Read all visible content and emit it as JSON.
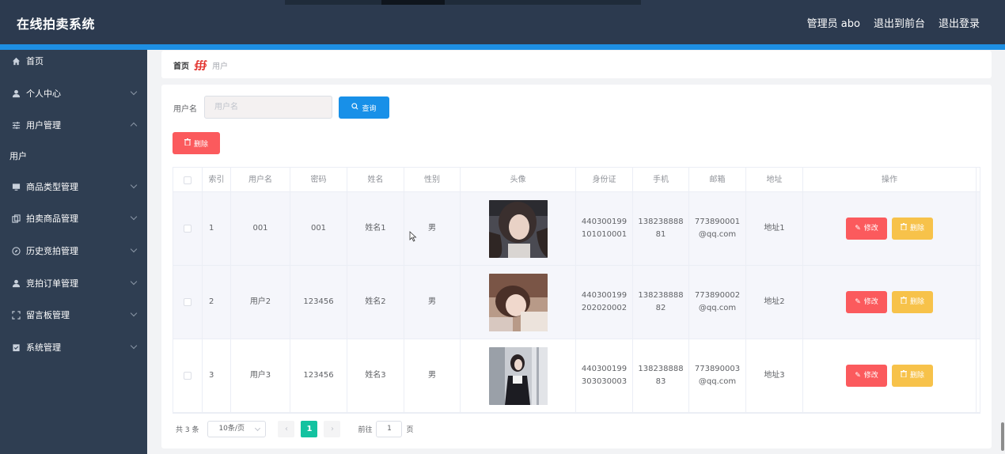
{
  "app": {
    "title": "在线拍卖系统"
  },
  "header": {
    "admin_label": "管理员 abo",
    "front_label": "退出到前台",
    "logout_label": "退出登录"
  },
  "sidebar": {
    "items": [
      {
        "label": "首页",
        "icon": "home-icon"
      },
      {
        "label": "个人中心",
        "icon": "user-icon"
      },
      {
        "label": "用户管理",
        "icon": "sliders-icon"
      },
      {
        "label": "用户",
        "icon": ""
      },
      {
        "label": "商品类型管理",
        "icon": "monitor-icon"
      },
      {
        "label": "拍卖商品管理",
        "icon": "copy-icon"
      },
      {
        "label": "历史竞拍管理",
        "icon": "compass-icon"
      },
      {
        "label": "竞拍订单管理",
        "icon": "user-icon"
      },
      {
        "label": "留言板管理",
        "icon": "frame-icon"
      },
      {
        "label": "系统管理",
        "icon": "clipboard-icon"
      }
    ]
  },
  "breadcrumb": {
    "home": "首页",
    "current": "用户"
  },
  "search": {
    "label": "用户名",
    "placeholder": "用户名",
    "button_label": "查询"
  },
  "actions": {
    "delete_label": "删除"
  },
  "table": {
    "headers": [
      "索引",
      "用户名",
      "密码",
      "姓名",
      "性别",
      "头像",
      "身份证",
      "手机",
      "邮箱",
      "地址",
      "操作"
    ],
    "edit_label": "修改",
    "delete_label": "删除",
    "rows": [
      {
        "index": "1",
        "username": "001",
        "password": "001",
        "name": "姓名1",
        "gender": "男",
        "id_card_1": "440300199",
        "id_card_2": "101010001",
        "phone_1": "138238888",
        "phone_2": "81",
        "email_1": "773890001",
        "email_2": "@qq.com",
        "address": "地址1"
      },
      {
        "index": "2",
        "username": "用户2",
        "password": "123456",
        "name": "姓名2",
        "gender": "男",
        "id_card_1": "440300199",
        "id_card_2": "202020002",
        "phone_1": "138238888",
        "phone_2": "82",
        "email_1": "773890002",
        "email_2": "@qq.com",
        "address": "地址2"
      },
      {
        "index": "3",
        "username": "用户3",
        "password": "123456",
        "name": "姓名3",
        "gender": "男",
        "id_card_1": "440300199",
        "id_card_2": "303030003",
        "phone_1": "138238888",
        "phone_2": "83",
        "email_1": "773890003",
        "email_2": "@qq.com",
        "address": "地址3"
      }
    ]
  },
  "pagination": {
    "total_label": "共 3 条",
    "page_size": "10条/页",
    "current_page": "1",
    "goto_label": "前往",
    "goto_value": "1",
    "page_suffix": "页"
  }
}
